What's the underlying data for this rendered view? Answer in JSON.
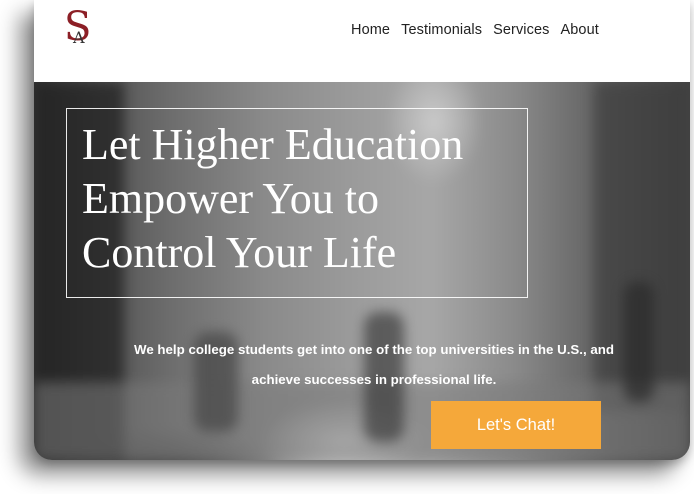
{
  "logo": {
    "letter_main": "S",
    "letter_sub": "A"
  },
  "nav": {
    "items": [
      {
        "label": "Home"
      },
      {
        "label": "Testimonials"
      },
      {
        "label": "Services"
      },
      {
        "label": "About"
      }
    ]
  },
  "hero": {
    "title": "Let Higher Education Empower You to Control Your Life",
    "subtitle": "We help college students get into one of the top universities in the U.S., and achieve successes in professional life.",
    "cta_label": "Let's Chat!"
  },
  "colors": {
    "accent": "#f5a83a",
    "brand": "#8c1f26"
  }
}
